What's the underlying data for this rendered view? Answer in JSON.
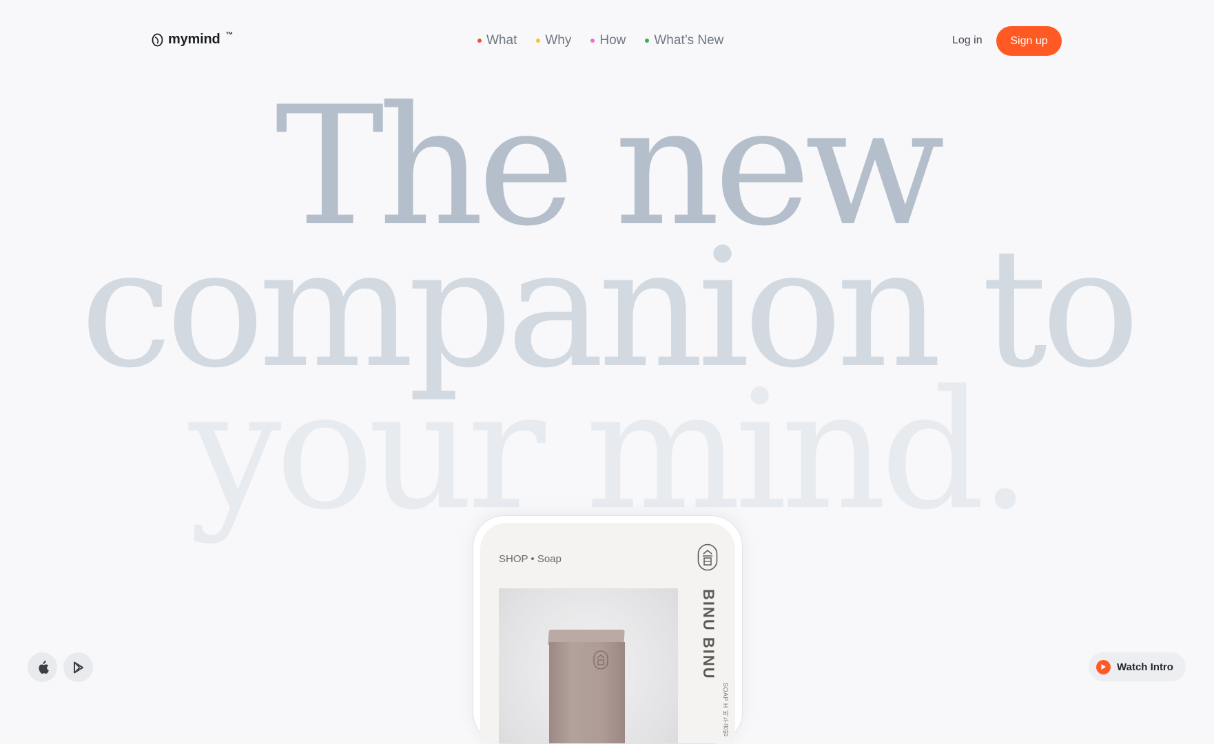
{
  "header": {
    "logo_text": "mymind",
    "logo_tm": "™",
    "nav": [
      {
        "label": "What",
        "dot_color": "#f0542a"
      },
      {
        "label": "Why",
        "dot_color": "#f5c518"
      },
      {
        "label": "How",
        "dot_color": "#ec6fc7"
      },
      {
        "label": "What’s New",
        "dot_color": "#3fae49"
      }
    ],
    "login_label": "Log in",
    "signup_label": "Sign up"
  },
  "hero": {
    "line1": "The new",
    "line2": "companion to",
    "line3": "your mind."
  },
  "phone_card": {
    "category": "SHOP • Soap",
    "brand": "BINU BINU",
    "brand_sub": "SOAP H  비누공방"
  },
  "footer": {
    "app_store_icon": "apple-icon",
    "play_store_icon": "google-play-icon",
    "watch_label": "Watch Intro"
  },
  "colors": {
    "accent": "#ff5a24",
    "background": "#f8f8fa"
  }
}
